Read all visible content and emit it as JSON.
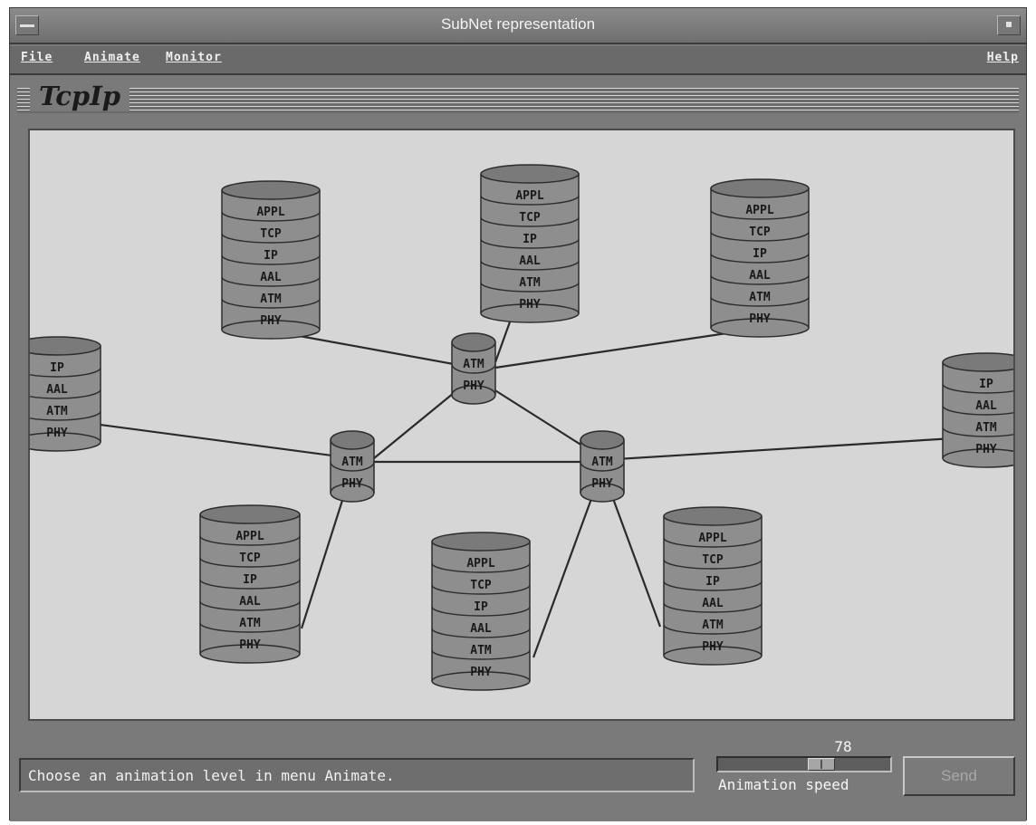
{
  "window": {
    "title": "SubNet representation"
  },
  "menubar": {
    "file": "File",
    "animate": "Animate",
    "monitor": "Monitor",
    "help": "Help"
  },
  "banner": {
    "text": "TcpIp"
  },
  "network": {
    "hosts": [
      {
        "layers": [
          "APPL",
          "TCP",
          "IP",
          "AAL",
          "ATM",
          "PHY"
        ]
      },
      {
        "layers": [
          "APPL",
          "TCP",
          "IP",
          "AAL",
          "ATM",
          "PHY"
        ]
      },
      {
        "layers": [
          "APPL",
          "TCP",
          "IP",
          "AAL",
          "ATM",
          "PHY"
        ]
      },
      {
        "layers": [
          "IP",
          "AAL",
          "ATM",
          "PHY"
        ]
      },
      {
        "layers": [
          "IP",
          "AAL",
          "ATM",
          "PHY"
        ]
      },
      {
        "layers": [
          "APPL",
          "TCP",
          "IP",
          "AAL",
          "ATM",
          "PHY"
        ]
      },
      {
        "layers": [
          "APPL",
          "TCP",
          "IP",
          "AAL",
          "ATM",
          "PHY"
        ]
      },
      {
        "layers": [
          "APPL",
          "TCP",
          "IP",
          "AAL",
          "ATM",
          "PHY"
        ]
      }
    ],
    "switches": [
      {
        "layers": [
          "ATM",
          "PHY"
        ]
      },
      {
        "layers": [
          "ATM",
          "PHY"
        ]
      },
      {
        "layers": [
          "ATM",
          "PHY"
        ]
      }
    ]
  },
  "status": {
    "message": "Choose an animation level in menu Animate."
  },
  "animation_speed": {
    "label": "Animation speed",
    "value": "78",
    "fraction": 0.62
  },
  "send_button": {
    "label": "Send"
  }
}
